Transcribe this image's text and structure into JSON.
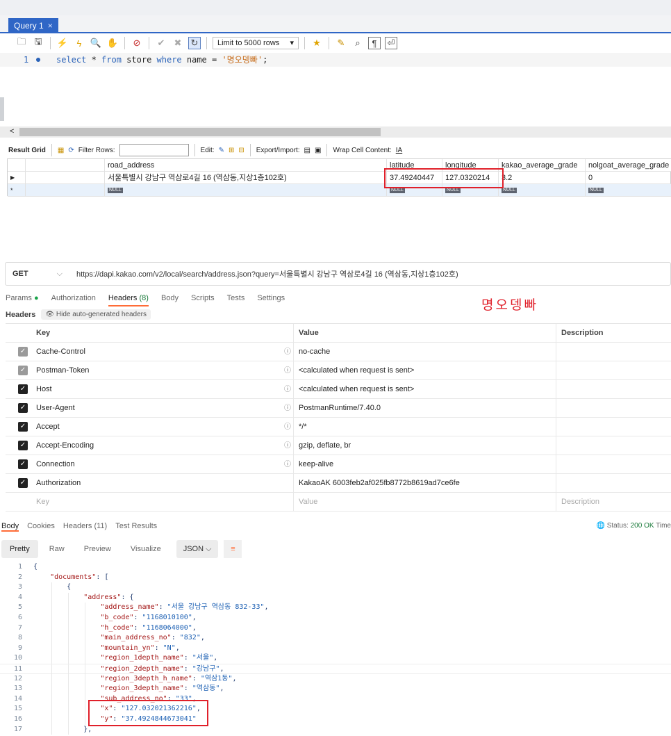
{
  "workbench": {
    "tab_label": "Query 1",
    "tab_close": "×",
    "limit_select": "Limit to 5000 rows",
    "editor": {
      "line_number": "1",
      "kw_select": "select",
      "star": " * ",
      "kw_from": "from",
      "table": " store ",
      "kw_where": "where",
      "column": " name = ",
      "value": "'명오뎅빠'",
      "semicolon": ";"
    },
    "scroll_arrow": "<",
    "result_toolbar": {
      "result_grid": "Result Grid",
      "filter_rows": "Filter Rows:",
      "edit": "Edit:",
      "export_import": "Export/Import:",
      "wrap_cell": "Wrap Cell Content:"
    },
    "grid": {
      "columns": [
        "road_address",
        "latitude",
        "longitude",
        "kakao_average_grade",
        "nolgoat_average_grade"
      ],
      "row": {
        "road_address": "서울특별시 강남구 역삼로4길 16 (역삼동,지상1층102호)",
        "latitude": "37.49240447",
        "longitude": "127.0320214",
        "kakao_average_grade": "3.2",
        "nolgoat_average_grade": "0"
      },
      "null_label": "NULL",
      "row_marker": "▶",
      "new_marker": "*"
    }
  },
  "postman": {
    "method": "GET",
    "url": "https://dapi.kakao.com/v2/local/search/address.json?query=서울특별시 강남구 역삼로4길 16 (역삼동,지상1층102호)",
    "tabs": {
      "params": "Params",
      "authorization": "Authorization",
      "headers": "Headers",
      "headers_count": "(8)",
      "body": "Body",
      "scripts": "Scripts",
      "tests": "Tests",
      "settings": "Settings"
    },
    "annotation": "명오뎅빠",
    "headers_label": "Headers",
    "hide_auto": "Hide auto-generated headers",
    "table_cols": {
      "key": "Key",
      "value": "Value",
      "description": "Description"
    },
    "headers": [
      {
        "key": "Cache-Control",
        "value": "no-cache",
        "auto": true
      },
      {
        "key": "Postman-Token",
        "value": "<calculated when request is sent>",
        "auto": true
      },
      {
        "key": "Host",
        "value": "<calculated when request is sent>",
        "auto": false
      },
      {
        "key": "User-Agent",
        "value": "PostmanRuntime/7.40.0",
        "auto": false
      },
      {
        "key": "Accept",
        "value": "*/*",
        "auto": false
      },
      {
        "key": "Accept-Encoding",
        "value": "gzip, deflate, br",
        "auto": false
      },
      {
        "key": "Connection",
        "value": "keep-alive",
        "auto": false
      },
      {
        "key": "Authorization",
        "value": "KakaoAK 6003feb2af025fb8772b8619ad7ce6fe",
        "auto": false
      }
    ],
    "placeholder_row": {
      "key": "Key",
      "value": "Value",
      "description": "Description"
    },
    "response_tabs": {
      "body": "Body",
      "cookies": "Cookies",
      "headers": "Headers (11)",
      "test_results": "Test Results"
    },
    "status_label": "Status:",
    "status_value": "200 OK",
    "status_time": "Time",
    "view_modes": [
      "Pretty",
      "Raw",
      "Preview",
      "Visualize"
    ],
    "format": "JSON",
    "json_lines": [
      {
        "n": "1",
        "indent": 0,
        "text": "{"
      },
      {
        "n": "2",
        "indent": 1,
        "key": "\"documents\"",
        "rest": ": ["
      },
      {
        "n": "3",
        "indent": 2,
        "text": "{"
      },
      {
        "n": "4",
        "indent": 3,
        "key": "\"address\"",
        "rest": ": {"
      },
      {
        "n": "5",
        "indent": 4,
        "key": "\"address_name\"",
        "sep": ": ",
        "val": "\"서울 강남구 역삼동 832-33\"",
        "tail": ","
      },
      {
        "n": "6",
        "indent": 4,
        "key": "\"b_code\"",
        "sep": ": ",
        "val": "\"1168010100\"",
        "tail": ","
      },
      {
        "n": "7",
        "indent": 4,
        "key": "\"h_code\"",
        "sep": ": ",
        "val": "\"1168064000\"",
        "tail": ","
      },
      {
        "n": "8",
        "indent": 4,
        "key": "\"main_address_no\"",
        "sep": ": ",
        "val": "\"832\"",
        "tail": ","
      },
      {
        "n": "9",
        "indent": 4,
        "key": "\"mountain_yn\"",
        "sep": ": ",
        "val": "\"N\"",
        "tail": ","
      },
      {
        "n": "10",
        "indent": 4,
        "key": "\"region_1depth_name\"",
        "sep": ": ",
        "val": "\"서울\"",
        "tail": ","
      },
      {
        "n": "11",
        "indent": 4,
        "key": "\"region_2depth_name\"",
        "sep": ": ",
        "val": "\"강남구\"",
        "tail": ","
      },
      {
        "n": "12",
        "indent": 4,
        "key": "\"region_3depth_h_name\"",
        "sep": ": ",
        "val": "\"역삼1동\"",
        "tail": ","
      },
      {
        "n": "13",
        "indent": 4,
        "key": "\"region_3depth_name\"",
        "sep": ": ",
        "val": "\"역삼동\"",
        "tail": ","
      },
      {
        "n": "14",
        "indent": 4,
        "key": "\"sub_address_no\"",
        "sep": ": ",
        "val": "\"33\"",
        "tail": ","
      },
      {
        "n": "15",
        "indent": 4,
        "key": "\"x\"",
        "sep": ": ",
        "val": "\"127.032021362216\"",
        "tail": ","
      },
      {
        "n": "16",
        "indent": 4,
        "key": "\"y\"",
        "sep": ": ",
        "val": "\"37.4924844673041\"",
        "tail": ""
      },
      {
        "n": "17",
        "indent": 3,
        "text": "},"
      }
    ]
  }
}
